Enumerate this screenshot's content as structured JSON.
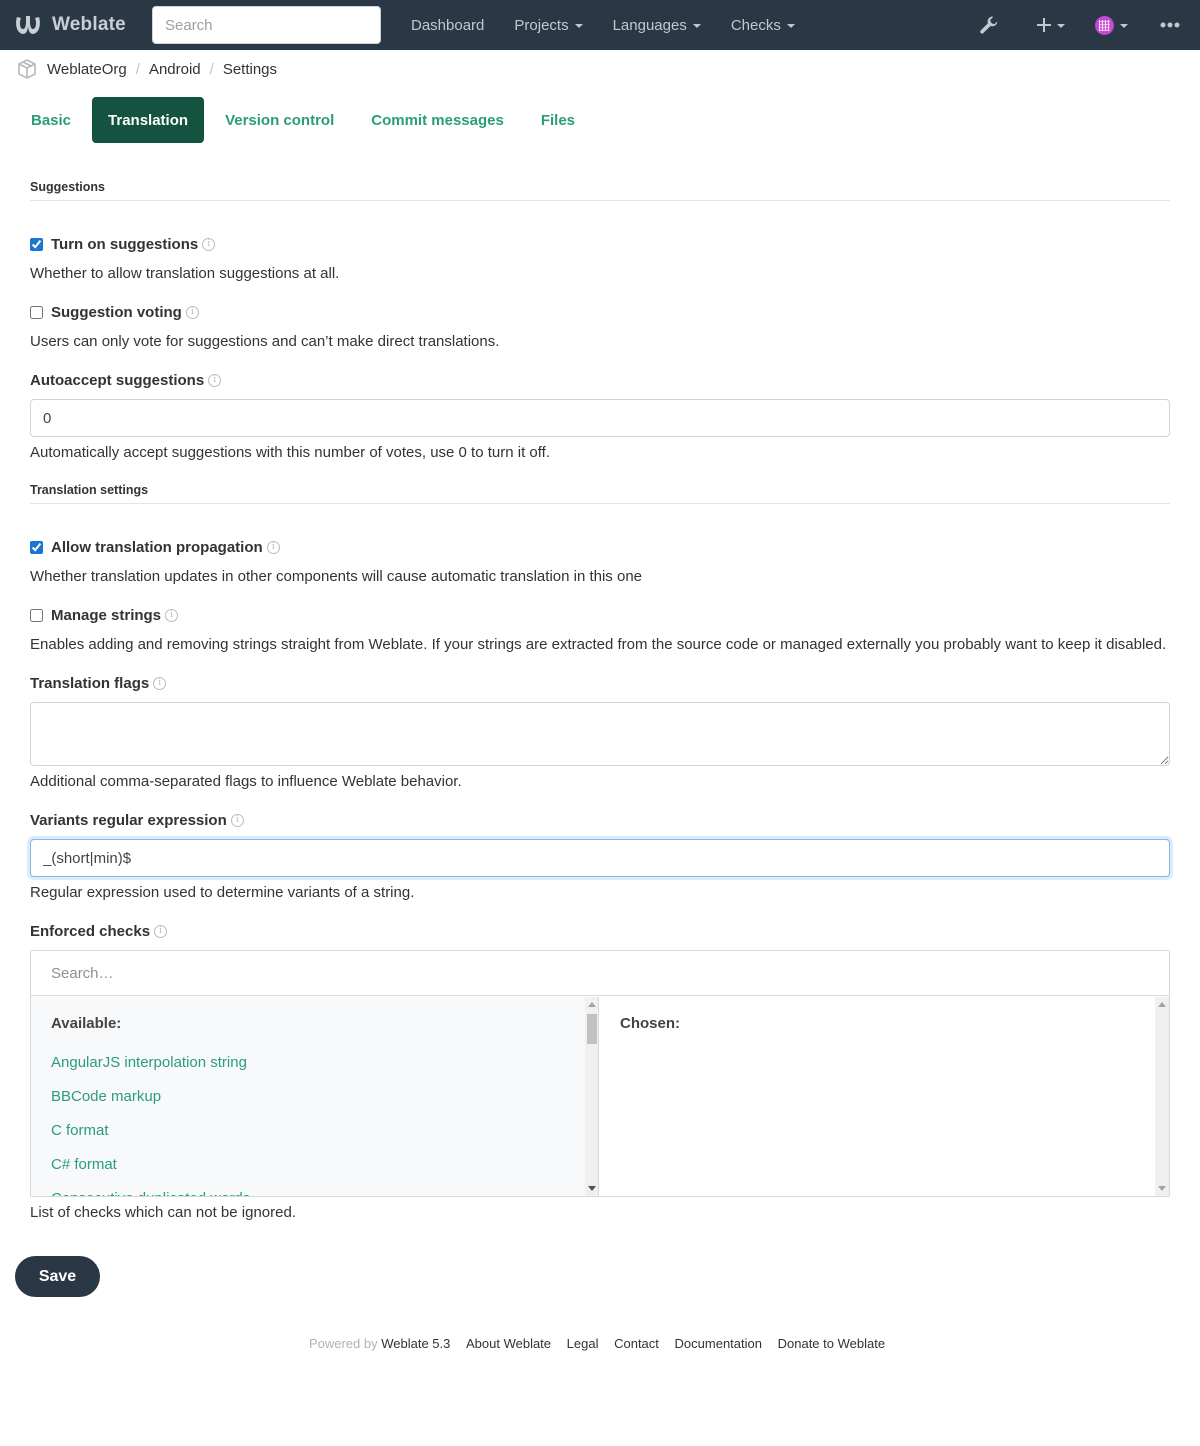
{
  "navbar": {
    "brand": "Weblate",
    "search_placeholder": "Search",
    "links": [
      {
        "label": "Dashboard",
        "dropdown": false
      },
      {
        "label": "Projects",
        "dropdown": true
      },
      {
        "label": "Languages",
        "dropdown": true
      },
      {
        "label": "Checks",
        "dropdown": true
      }
    ],
    "icons": [
      "wrench-icon",
      "plus-icon",
      "avatar",
      "more-icon"
    ]
  },
  "breadcrumb": {
    "items": [
      "WeblateOrg",
      "Android",
      "Settings"
    ],
    "separator": "/"
  },
  "tabs": [
    {
      "label": "Basic",
      "active": false
    },
    {
      "label": "Translation",
      "active": true
    },
    {
      "label": "Version control",
      "active": false
    },
    {
      "label": "Commit messages",
      "active": false
    },
    {
      "label": "Files",
      "active": false
    }
  ],
  "sections": {
    "suggestions": "Suggestions",
    "translation_settings": "Translation settings"
  },
  "fields": {
    "turn_on_suggestions": {
      "label": "Turn on suggestions",
      "checked": true,
      "help": "Whether to allow translation suggestions at all."
    },
    "suggestion_voting": {
      "label": "Suggestion voting",
      "checked": false,
      "help": "Users can only vote for suggestions and can’t make direct translations."
    },
    "autoaccept_suggestions": {
      "label": "Autoaccept suggestions",
      "value": "0",
      "help": "Automatically accept suggestions with this number of votes, use 0 to turn it off."
    },
    "allow_propagation": {
      "label": "Allow translation propagation",
      "checked": true,
      "help": "Whether translation updates in other components will cause automatic translation in this one"
    },
    "manage_strings": {
      "label": "Manage strings",
      "checked": false,
      "help": "Enables adding and removing strings straight from Weblate. If your strings are extracted from the source code or managed externally you probably want to keep it disabled."
    },
    "translation_flags": {
      "label": "Translation flags",
      "value": "",
      "help": "Additional comma-separated flags to influence Weblate behavior."
    },
    "variants_regex": {
      "label": "Variants regular expression",
      "value": "_(short|min)$",
      "help": "Regular expression used to determine variants of a string."
    },
    "enforced_checks": {
      "label": "Enforced checks",
      "search_placeholder": "Search…",
      "available_heading": "Available:",
      "chosen_heading": "Chosen:",
      "available": [
        "AngularJS interpolation string",
        "BBCode markup",
        "C format",
        "C# format",
        "Consecutive duplicated words"
      ],
      "chosen": [],
      "help": "List of checks which can not be ignored."
    }
  },
  "save_label": "Save",
  "footer": {
    "powered_by": "Powered by",
    "links": [
      "Weblate 5.3",
      "About Weblate",
      "Legal",
      "Contact",
      "Documentation",
      "Donate to Weblate"
    ]
  },
  "colors": {
    "navbar": "#2a3744",
    "accent_link": "#2a9d7a",
    "active_tab": "#14533f",
    "checkbox": "#1976d2"
  }
}
